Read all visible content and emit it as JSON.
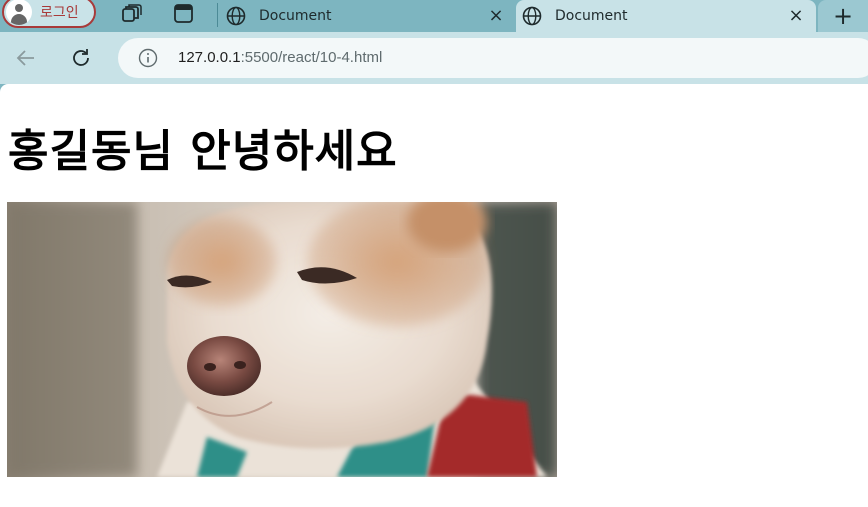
{
  "browser": {
    "profile_label": "로그인",
    "tabs": [
      {
        "title": "Document",
        "active": false
      },
      {
        "title": "Document",
        "active": true
      }
    ],
    "tab_close_glyph": "×",
    "new_tab_glyph": "+",
    "address": {
      "host": "127.0.0.1",
      "path": ":5500/react/10-4.html"
    },
    "colors": {
      "tabstrip": "#7db5c0",
      "active_tab": "#c8e2e7",
      "profile_border": "#a83a3a"
    }
  },
  "page": {
    "heading": "홍길동님 안녕하세요",
    "image": {
      "subject": "dog-photo"
    }
  }
}
